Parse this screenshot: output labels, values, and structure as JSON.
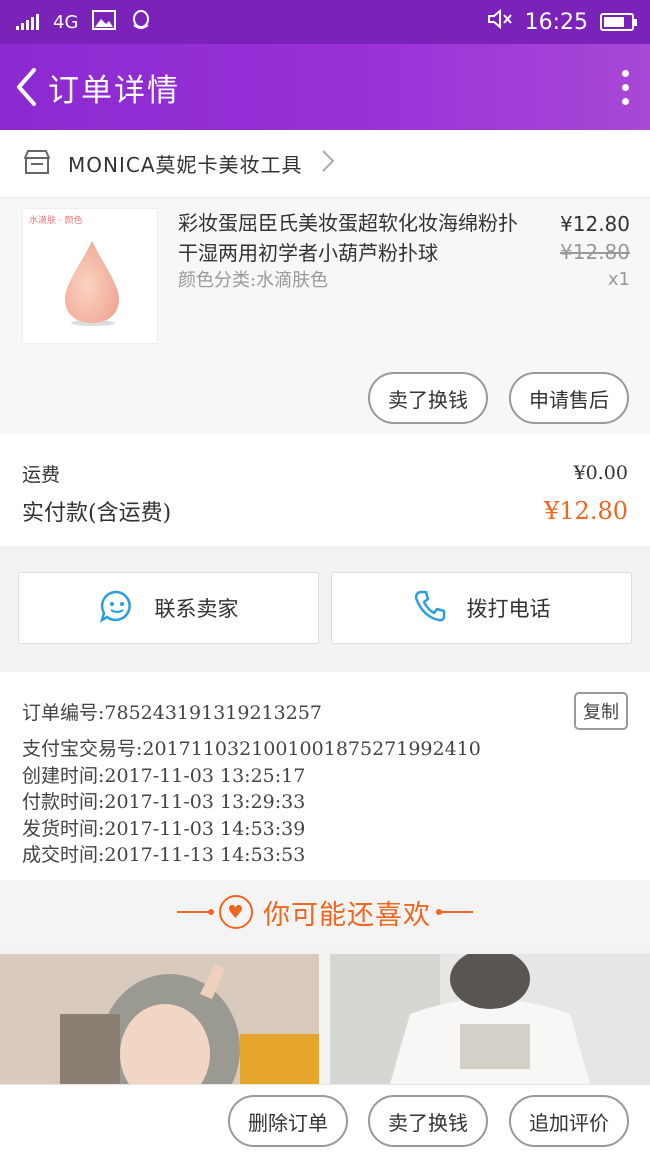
{
  "status_bar": {
    "network": "4G",
    "time": "16:25"
  },
  "nav": {
    "title": "订单详情"
  },
  "shop": {
    "name": "MONICA莫妮卡美妆工具"
  },
  "product": {
    "image_caption": "水滴肤 · 颜色",
    "title": "彩妆蛋屈臣氏美妆蛋超软化妆海绵粉扑干湿两用初学者小葫芦粉扑球",
    "variant": "颜色分类:水滴肤色",
    "price": "¥12.80",
    "original_price": "¥12.80",
    "quantity": "x1",
    "buttons": [
      "卖了换钱",
      "申请售后"
    ]
  },
  "fees": {
    "shipping_label": "运费",
    "shipping_value": "¥0.00",
    "paid_label": "实付款(含运费)",
    "paid_value": "¥12.80"
  },
  "contact": {
    "seller_label": "联系卖家",
    "phone_label": "拨打电话"
  },
  "order": {
    "number": "订单编号:785243191319213257",
    "copy_label": "复制",
    "alipay": "支付宝交易号:2017110321001001875271992410",
    "created": "创建时间:2017-11-03 13:25:17",
    "paid": "付款时间:2017-11-03 13:29:33",
    "shipped": "发货时间:2017-11-03 14:53:39",
    "completed": "成交时间:2017-11-13 14:53:53"
  },
  "recommend": {
    "title": "你可能还喜欢"
  },
  "bottom": {
    "buttons": [
      "删除订单",
      "卖了换钱",
      "追加评价"
    ]
  },
  "colors": {
    "purple": "#8b2ad0",
    "accent": "#f0661f"
  }
}
